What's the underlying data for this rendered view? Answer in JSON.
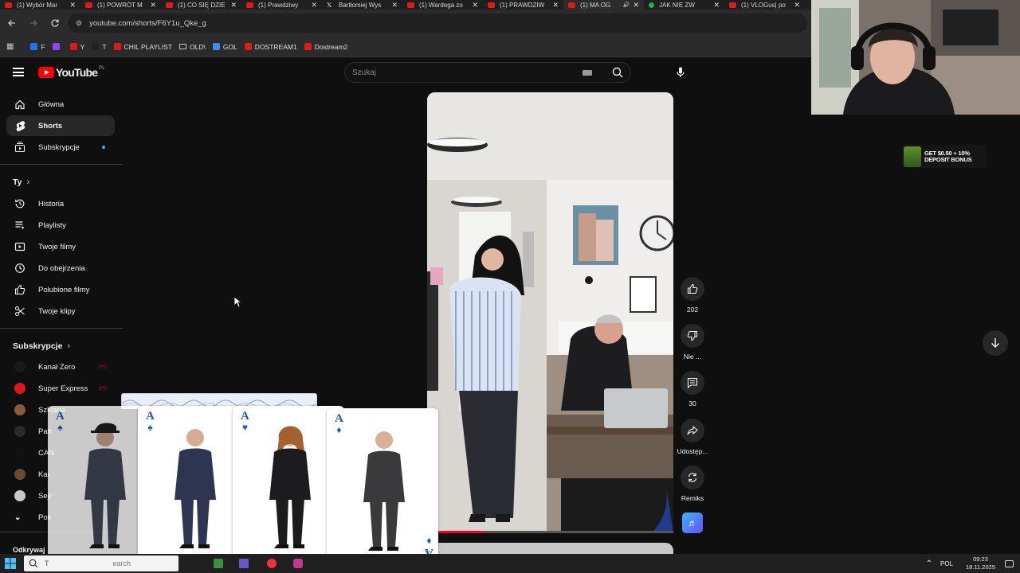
{
  "browser": {
    "tabs": [
      {
        "title": "(1) Wybór Mar",
        "icon": "youtube-favicon"
      },
      {
        "title": "(1) POWRÓT M",
        "icon": "youtube-favicon"
      },
      {
        "title": "(1) CO SIĘ DZIE",
        "icon": "youtube-favicon"
      },
      {
        "title": "(1) Prawdziwy",
        "icon": "youtube-favicon"
      },
      {
        "title": "Bartłomiej Wys",
        "icon": "x-favicon"
      },
      {
        "title": "(1) Wardega zo",
        "icon": "youtube-favicon"
      },
      {
        "title": "(1) PRAWDZIW",
        "icon": "youtube-favicon"
      },
      {
        "title": "(1) MA OG",
        "icon": "youtube-favicon",
        "active": true
      },
      {
        "title": "JAK NIE ZW",
        "icon": "green-dot-favicon"
      },
      {
        "title": "(1) VLOGus| po",
        "icon": "youtube-favicon"
      }
    ],
    "url": "youtube.com/shorts/F6Y1u_Qke_g",
    "bookmarks": [
      {
        "label": "F",
        "color": "#1877f2"
      },
      {
        "label": "",
        "color": "#9146ff"
      },
      {
        "label": "Y",
        "color": "#e31919"
      },
      {
        "label": "T",
        "color": "#222222"
      },
      {
        "label": "CHIL PLAYLIST",
        "color": "#e31919"
      },
      {
        "label": "OLD\\",
        "color": "folder"
      },
      {
        "label": "GOL",
        "color": "#3b8ef0"
      },
      {
        "label": "DOSTREAM1",
        "color": "#e31919"
      },
      {
        "label": "Dostream2",
        "color": "#e31919"
      }
    ]
  },
  "youtube": {
    "logo_text": "YouTube",
    "country_code": "PL",
    "search_placeholder": "Szukaj"
  },
  "sidebar": {
    "main": [
      {
        "label": "Główna",
        "icon": "home-icon"
      },
      {
        "label": "Shorts",
        "icon": "shorts-icon",
        "active": true
      },
      {
        "label": "Subskrypcje",
        "icon": "subscriptions-icon"
      }
    ],
    "you_heading": "Ty",
    "you": [
      {
        "label": "Historia",
        "icon": "history-icon"
      },
      {
        "label": "Playlisty",
        "icon": "playlist-icon"
      },
      {
        "label": "Twoje filmy",
        "icon": "video-icon"
      },
      {
        "label": "Do obejrzenia",
        "icon": "clock-icon"
      },
      {
        "label": "Polubione filmy",
        "icon": "thumbs-up-icon"
      },
      {
        "label": "Twoje klipy",
        "icon": "scissors-icon"
      }
    ],
    "subs_heading": "Subskrypcje",
    "subs": [
      {
        "label": "Kanał Zero",
        "color": "#1a1a1a",
        "live": true
      },
      {
        "label": "Super Express",
        "color": "#e0161b",
        "live": true
      },
      {
        "label": "Szklana"
      },
      {
        "label": "Patr"
      },
      {
        "label": "CAN"
      },
      {
        "label": "Kar"
      },
      {
        "label": "Sejr"
      },
      {
        "label": "Pok"
      }
    ],
    "footer_heading": "Odkrywaj"
  },
  "short": {
    "progress": 0.23,
    "likes": "202",
    "dislike_label": "Nie ...",
    "comments": "30",
    "share_label": "Udostęp...",
    "remix_label": "Remiks"
  },
  "promo": {
    "line1": "GET $0.50 + 10%",
    "line2": "DEPOSIT BONUS"
  },
  "cards": [
    {
      "rank": "A",
      "suit": "♠"
    },
    {
      "rank": "A",
      "suit": "♠"
    },
    {
      "rank": "A",
      "suit": "♥"
    },
    {
      "rank": "A",
      "suit": "♦"
    }
  ],
  "taskbar": {
    "search_text": "T",
    "search_hint": "earch",
    "lang": "POL",
    "time": "09:23",
    "date": "18.11.2025"
  }
}
